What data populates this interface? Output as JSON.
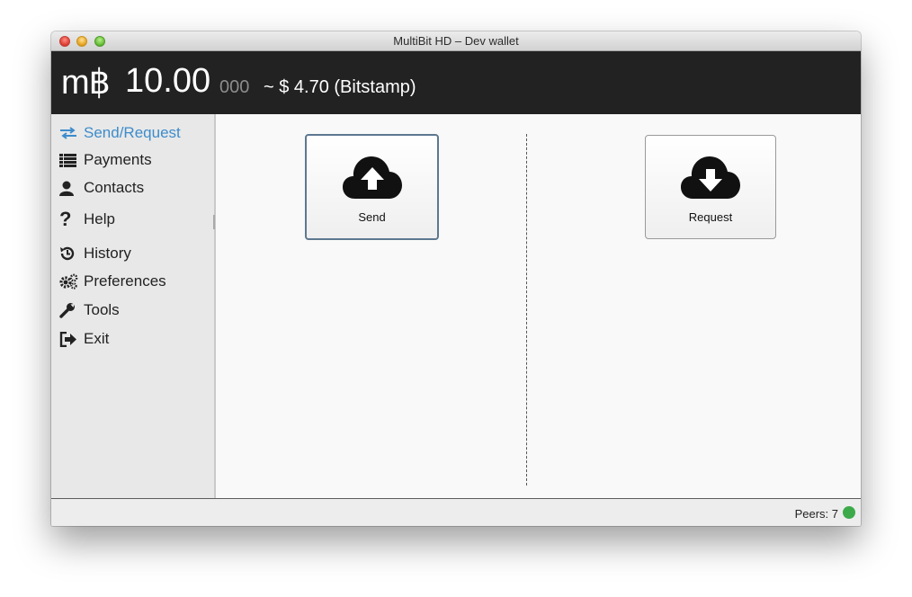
{
  "window": {
    "title": "MultiBit HD – Dev wallet"
  },
  "header": {
    "currency_symbol": "m฿",
    "balance_main": "10.00",
    "balance_secondary": "000",
    "fiat_text": "~ $ 4.70 (Bitstamp)"
  },
  "sidebar": {
    "items": [
      {
        "label": "Send/Request",
        "icon": "exchange-arrows-icon",
        "active": true
      },
      {
        "label": "Payments",
        "icon": "list-icon",
        "active": false
      },
      {
        "label": "Contacts",
        "icon": "user-icon",
        "active": false
      },
      {
        "label": "Help",
        "icon": "question-icon",
        "active": false
      },
      {
        "label": "History",
        "icon": "history-icon",
        "active": false
      },
      {
        "label": "Preferences",
        "icon": "gears-icon",
        "active": false
      },
      {
        "label": "Tools",
        "icon": "wrench-icon",
        "active": false
      },
      {
        "label": "Exit",
        "icon": "sign-out-icon",
        "active": false
      }
    ]
  },
  "main": {
    "send_button": {
      "label": "Send",
      "icon": "cloud-upload-icon"
    },
    "request_button": {
      "label": "Request",
      "icon": "cloud-download-icon"
    }
  },
  "statusbar": {
    "peers_text": "Peers: 7",
    "status_color": "#3daa4a"
  },
  "colors": {
    "accent": "#3d8ccc",
    "header_bg": "#222222",
    "sidebar_bg": "#e8e8e8"
  }
}
